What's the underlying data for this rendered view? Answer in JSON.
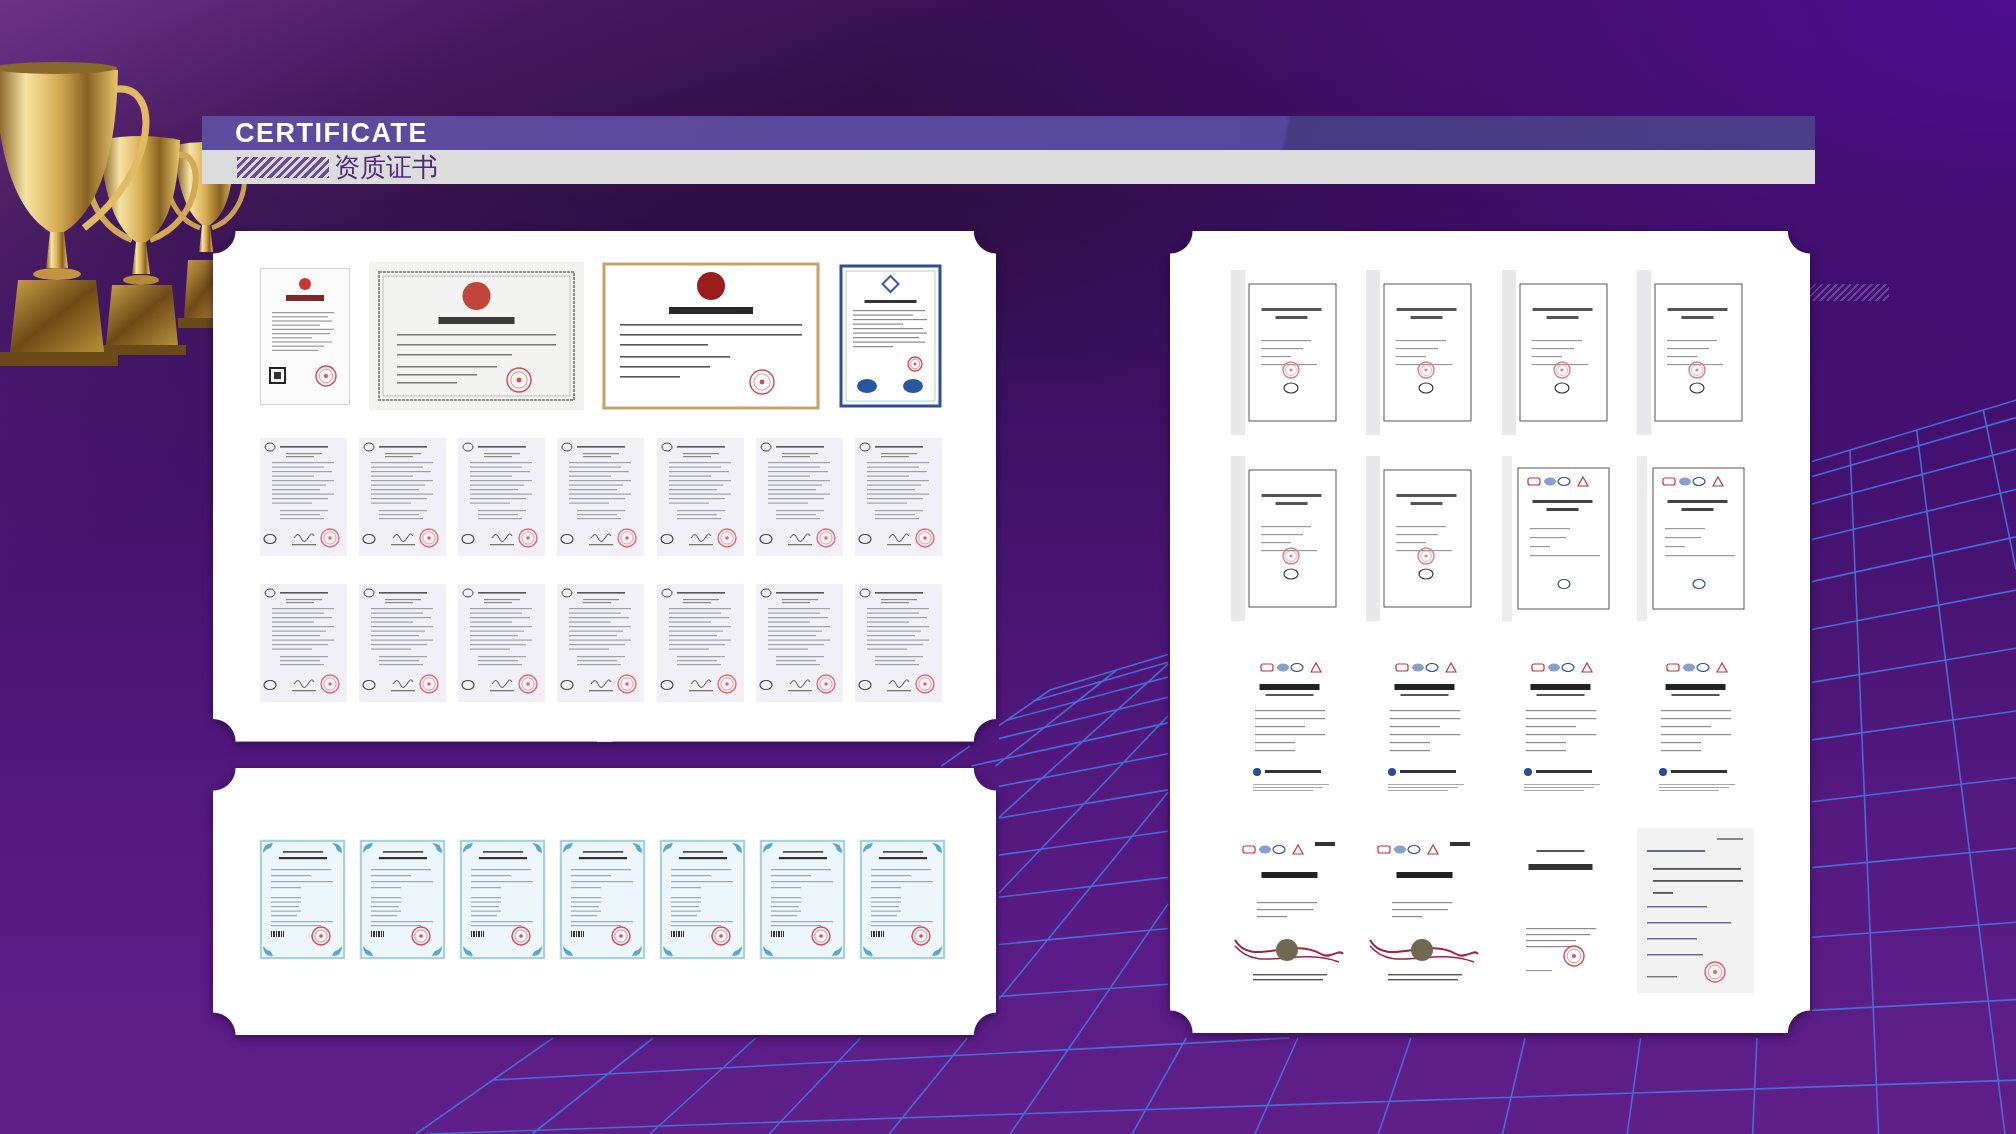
{
  "header": {
    "title": "CERTIFICATE",
    "subtitle": "资质证书"
  },
  "left_top_panel": {
    "rows": [
      {
        "documents": [
          {
            "kind": "license"
          },
          {
            "kind": "registration"
          },
          {
            "kind": "honor"
          },
          {
            "kind": "quality"
          }
        ]
      },
      {
        "documents": [
          {
            "kind": "ccc"
          },
          {
            "kind": "ccc"
          },
          {
            "kind": "ccc"
          },
          {
            "kind": "ccc"
          },
          {
            "kind": "ccc"
          },
          {
            "kind": "ccc"
          },
          {
            "kind": "ccc"
          }
        ]
      },
      {
        "documents": [
          {
            "kind": "ccc"
          },
          {
            "kind": "ccc"
          },
          {
            "kind": "ccc"
          },
          {
            "kind": "ccc"
          },
          {
            "kind": "ccc"
          },
          {
            "kind": "ccc"
          },
          {
            "kind": "ccc"
          }
        ]
      }
    ]
  },
  "left_bottom_panel": {
    "rows": [
      {
        "documents": [
          {
            "kind": "copyright"
          },
          {
            "kind": "copyright"
          },
          {
            "kind": "copyright"
          },
          {
            "kind": "copyright"
          },
          {
            "kind": "copyright"
          },
          {
            "kind": "copyright"
          },
          {
            "kind": "copyright"
          }
        ]
      }
    ]
  },
  "right_panel": {
    "rows": [
      {
        "documents": [
          {
            "kind": "report"
          },
          {
            "kind": "report"
          },
          {
            "kind": "report"
          },
          {
            "kind": "report"
          }
        ]
      },
      {
        "documents": [
          {
            "kind": "report"
          },
          {
            "kind": "report"
          },
          {
            "kind": "logo-report"
          },
          {
            "kind": "logo-report"
          }
        ]
      },
      {
        "documents": [
          {
            "kind": "inspection"
          },
          {
            "kind": "inspection"
          },
          {
            "kind": "inspection"
          },
          {
            "kind": "inspection"
          }
        ]
      },
      {
        "documents": [
          {
            "kind": "seal-report"
          },
          {
            "kind": "seal-report"
          },
          {
            "kind": "review"
          },
          {
            "kind": "letter"
          }
        ]
      }
    ]
  }
}
